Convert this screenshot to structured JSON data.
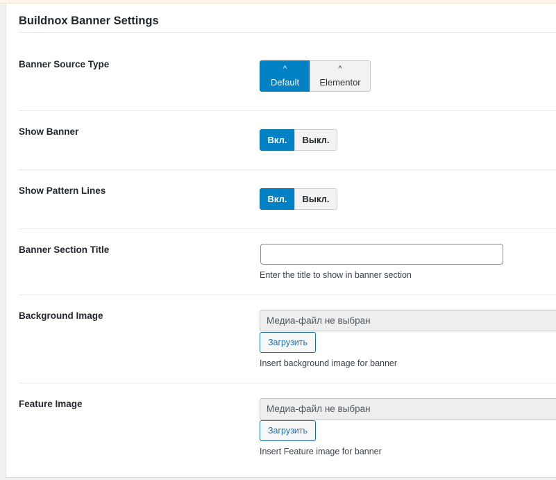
{
  "panel": {
    "title": "Buildnox Banner Settings"
  },
  "rows": {
    "banner_source": {
      "label": "Banner Source Type",
      "options": [
        {
          "caret": "^",
          "label": "Default",
          "selected": true
        },
        {
          "caret": "^",
          "label": "Elementor",
          "selected": false
        }
      ]
    },
    "show_banner": {
      "label": "Show Banner",
      "on_label": "Вкл.",
      "off_label": "Выкл.",
      "state": "on"
    },
    "show_pattern_lines": {
      "label": "Show Pattern Lines",
      "on_label": "Вкл.",
      "off_label": "Выкл.",
      "state": "on"
    },
    "banner_section_title": {
      "label": "Banner Section Title",
      "value": "",
      "description": "Enter the title to show in banner section"
    },
    "background_image": {
      "label": "Background Image",
      "media_placeholder": "Медиа-файл не выбран",
      "upload_label": "Загрузить",
      "description": "Insert background image for banner"
    },
    "feature_image": {
      "label": "Feature Image",
      "media_placeholder": "Медиа-файл не выбран",
      "upload_label": "Загрузить",
      "description": "Insert Feature image for banner"
    }
  },
  "colors": {
    "accent": "#0281c4",
    "link": "#2271b1"
  }
}
